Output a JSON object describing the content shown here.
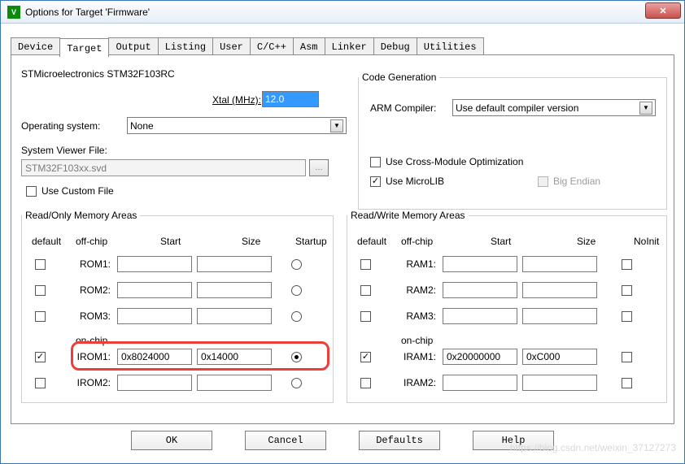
{
  "window": {
    "title": "Options for Target 'Firmware'"
  },
  "tabs": [
    "Device",
    "Target",
    "Output",
    "Listing",
    "User",
    "C/C++",
    "Asm",
    "Linker",
    "Debug",
    "Utilities"
  ],
  "activeTab": "Target",
  "device": "STMicroelectronics STM32F103RC",
  "xtal": {
    "label_prefix": "X",
    "label_mid": "tal (MHz):",
    "value": "12.0"
  },
  "os": {
    "label": "Operating system:",
    "value": "None"
  },
  "svf": {
    "label": "System Viewer File:",
    "value": "STM32F103xx.svd",
    "custom_label": "Use Custom File"
  },
  "codegen": {
    "legend": "Code Generation",
    "arm_label": "ARM Compiler:",
    "arm_value": "Use default compiler version",
    "cross_label": "Use Cross-Module Optimization",
    "microlib_label": "Use MicroLIB",
    "bigendian_label": "Big Endian"
  },
  "ro": {
    "legend": "Read/Only Memory Areas",
    "cols": {
      "default": "default",
      "offchip": "off-chip",
      "start": "Start",
      "size": "Size",
      "startup": "Startup",
      "onchip": "on-chip"
    },
    "rows": [
      {
        "name": "ROM1:",
        "def": false,
        "start": "",
        "size": "",
        "startup": false
      },
      {
        "name": "ROM2:",
        "def": false,
        "start": "",
        "size": "",
        "startup": false
      },
      {
        "name": "ROM3:",
        "def": false,
        "start": "",
        "size": "",
        "startup": false
      },
      {
        "name": "IROM1:",
        "def": true,
        "start": "0x8024000",
        "size": "0x14000",
        "startup": true
      },
      {
        "name": "IROM2:",
        "def": false,
        "start": "",
        "size": "",
        "startup": false
      }
    ]
  },
  "rw": {
    "legend": "Read/Write Memory Areas",
    "cols": {
      "default": "default",
      "offchip": "off-chip",
      "start": "Start",
      "size": "Size",
      "noinit": "NoInit",
      "onchip": "on-chip"
    },
    "rows": [
      {
        "name": "RAM1:",
        "def": false,
        "start": "",
        "size": "",
        "noinit": false
      },
      {
        "name": "RAM2:",
        "def": false,
        "start": "",
        "size": "",
        "noinit": false
      },
      {
        "name": "RAM3:",
        "def": false,
        "start": "",
        "size": "",
        "noinit": false
      },
      {
        "name": "IRAM1:",
        "def": true,
        "start": "0x20000000",
        "size": "0xC000",
        "noinit": false
      },
      {
        "name": "IRAM2:",
        "def": false,
        "start": "",
        "size": "",
        "noinit": false
      }
    ]
  },
  "buttons": {
    "ok": "OK",
    "cancel": "Cancel",
    "defaults": "Defaults",
    "help": "Help"
  },
  "watermark": "https://blog.csdn.net/weixin_37127273"
}
